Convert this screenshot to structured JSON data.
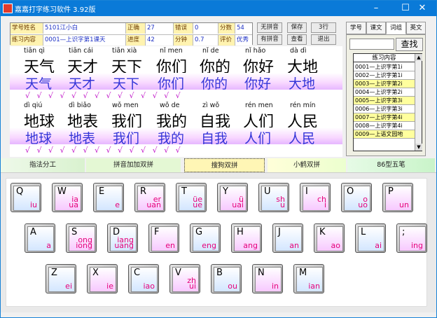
{
  "window": {
    "title": "嘉嘉打字练习软件 3.92版",
    "controls": {
      "min": "–",
      "max": "☐",
      "close": "✕"
    }
  },
  "info": {
    "student_label": "学号姓名",
    "student_value": "5101江小白",
    "correct_label": "正确",
    "correct_value": "27",
    "error_label": "错误",
    "error_value": "0",
    "score_label": "分数",
    "score_value": "54",
    "content_label": "练习内容",
    "content_value": "0001—上识字第1课天",
    "progress_label": "进度",
    "progress_value": "42",
    "minute_label": "分钟",
    "minute_value": "0.7",
    "rating_label": "评价",
    "rating_value": "优秀"
  },
  "buttons": {
    "no_pinyin": "无拼音",
    "has_pinyin": "有拼音",
    "save": "保存",
    "view": "查看",
    "lines": "3行",
    "exit": "退出",
    "search": "查找"
  },
  "tabs": [
    "学号",
    "课文",
    "词组",
    "英文"
  ],
  "list": {
    "header": "练习内容",
    "items": [
      "0001—上识字第1i",
      "0002—上识字第1i",
      "0003—上识字第2i",
      "0004—上识字第2i",
      "0005—上识字第3i",
      "0006—上识字第3i",
      "0007—上识字第4i",
      "0008—上识字第4i",
      "0009—上语文园地"
    ]
  },
  "lines": [
    {
      "pinyin": [
        "tiān qì",
        "tiān cái",
        "tiān xià",
        "nǐ men",
        "nǐ de",
        "nǐ hǎo",
        "dà dì"
      ],
      "hanzi": [
        "天气",
        "天才",
        "天下",
        "你们",
        "你的",
        "你好",
        "大地"
      ],
      "typed": [
        "天气",
        "天才",
        "天下",
        "你们",
        "你的",
        "你好",
        "大地"
      ],
      "checks": "√ √  √ √  √ √  √ √  √ √  √ √  √ √"
    },
    {
      "pinyin": [
        "dì qiú",
        "dì biǎo",
        "wǒ men",
        "wǒ de",
        "zì wǒ",
        "rén men",
        "rén mín"
      ],
      "hanzi": [
        "地球",
        "地表",
        "我们",
        "我的",
        "自我",
        "人们",
        "人民"
      ],
      "typed": [
        "地球",
        "地表",
        "我们",
        "我的",
        "自我",
        "人们",
        "人民"
      ],
      "checks": "√ √  √ √  √ √  √ √  √ √  √ √  √ √"
    }
  ],
  "modes": [
    "指法分工",
    "拼音加加双拼",
    "搜狗双拼",
    "小鹤双拼",
    "86型五笔"
  ],
  "keyboard": {
    "row1": [
      {
        "k": "Q",
        "a": "",
        "b": "iu"
      },
      {
        "k": "W",
        "a": "ia",
        "b": "ua"
      },
      {
        "k": "E",
        "a": "",
        "b": "e"
      },
      {
        "k": "R",
        "a": "er",
        "b": "uan"
      },
      {
        "k": "T",
        "a": "üe",
        "b": "ue"
      },
      {
        "k": "Y",
        "a": "ü",
        "b": "uai"
      },
      {
        "k": "U",
        "a": "sh",
        "b": "u"
      },
      {
        "k": "I",
        "a": "ch",
        "b": "i"
      },
      {
        "k": "O",
        "a": "o",
        "b": "uo"
      },
      {
        "k": "P",
        "a": "",
        "b": "un"
      }
    ],
    "row2": [
      {
        "k": "A",
        "a": "",
        "b": "a"
      },
      {
        "k": "S",
        "a": "ong",
        "b": "iong"
      },
      {
        "k": "D",
        "a": "iang",
        "b": "uang"
      },
      {
        "k": "F",
        "a": "",
        "b": "en"
      },
      {
        "k": "G",
        "a": "",
        "b": "eng"
      },
      {
        "k": "H",
        "a": "",
        "b": "ang"
      },
      {
        "k": "J",
        "a": "",
        "b": "an"
      },
      {
        "k": "K",
        "a": "",
        "b": "ao"
      },
      {
        "k": "L",
        "a": "",
        "b": "ai"
      },
      {
        "k": ";",
        "a": "",
        "b": "ing"
      }
    ],
    "row3": [
      {
        "k": "Z",
        "a": "",
        "b": "ei"
      },
      {
        "k": "X",
        "a": "",
        "b": "ie"
      },
      {
        "k": "C",
        "a": "",
        "b": "iao"
      },
      {
        "k": "V",
        "a": "zh",
        "b": "ui"
      },
      {
        "k": "B",
        "a": "",
        "b": "ou"
      },
      {
        "k": "N",
        "a": "",
        "b": "in"
      },
      {
        "k": "M",
        "a": "",
        "b": "ian"
      }
    ]
  },
  "colors": {
    "titlebar": "#0a7ad8",
    "label_bg": "#fff3b0",
    "typed_text": "#3536d8",
    "check": "#c014c8",
    "key_hint": "#e6007a"
  }
}
